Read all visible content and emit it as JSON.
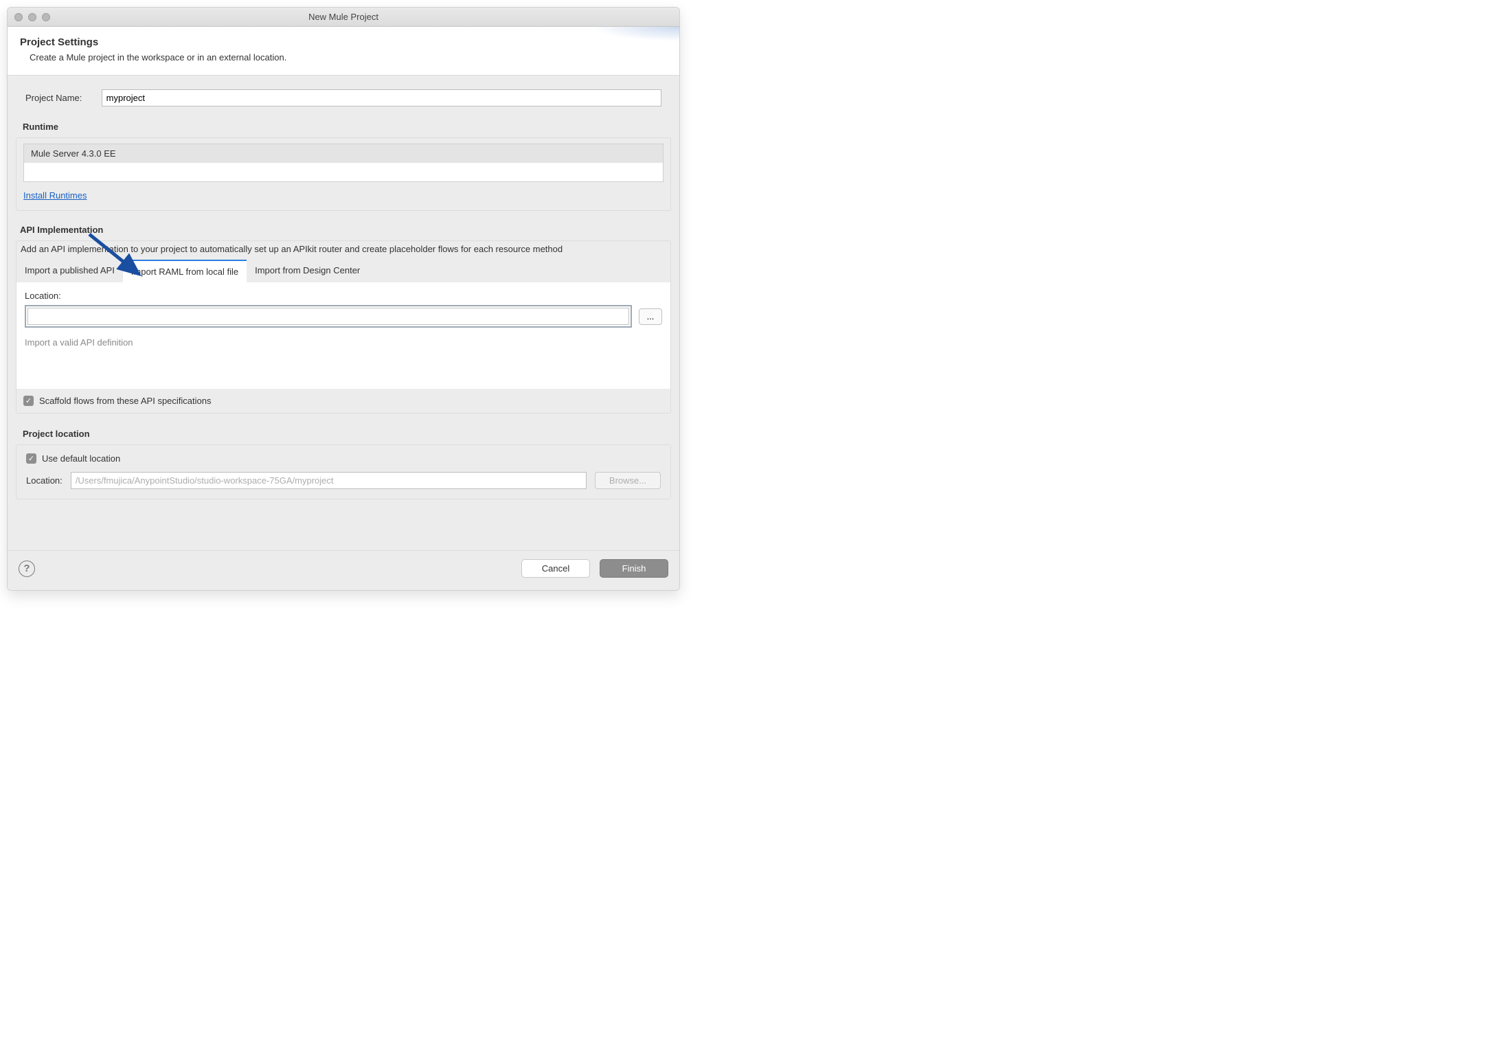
{
  "titlebar": {
    "title": "New Mule Project"
  },
  "header": {
    "title": "Project Settings",
    "description": "Create a Mule project in the workspace or in an external location."
  },
  "project_name": {
    "label": "Project Name:",
    "value": "myproject"
  },
  "runtime": {
    "section_title": "Runtime",
    "selected": "Mule Server 4.3.0 EE",
    "install_link": "Install Runtimes"
  },
  "api_impl": {
    "section_title": "API Implementation",
    "description": "Add an API implementation to your project to automatically set up an APIkit router and create placeholder flows for each resource method",
    "tabs": [
      {
        "label": "Import a published API",
        "active": false
      },
      {
        "label": "Import RAML from local file",
        "active": true
      },
      {
        "label": "Import from Design Center",
        "active": false
      }
    ],
    "location_label": "Location:",
    "location_value": "",
    "browse_label": "...",
    "hint": "Import a valid API definition",
    "scaffold_label": "Scaffold flows from these API specifications",
    "scaffold_checked": true
  },
  "project_location": {
    "section_title": "Project location",
    "use_default_label": "Use default location",
    "use_default_checked": true,
    "location_label": "Location:",
    "location_value": "/Users/fmujica/AnypointStudio/studio-workspace-75GA/myproject",
    "browse_label": "Browse..."
  },
  "footer": {
    "cancel": "Cancel",
    "finish": "Finish"
  }
}
